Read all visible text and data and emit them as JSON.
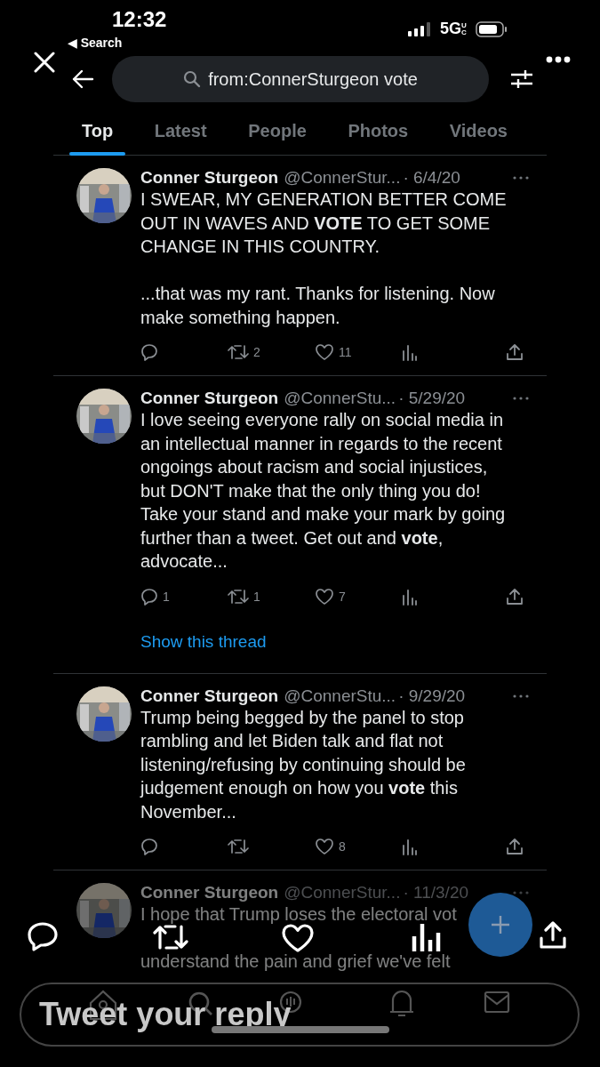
{
  "status_bar": {
    "time": "12:32",
    "back_label": "◀ Search",
    "network": "5G",
    "network_suffix": "UC"
  },
  "search": {
    "value": "from:ConnerSturgeon vote"
  },
  "tabs": [
    {
      "label": "Top",
      "selected": true
    },
    {
      "label": "Latest",
      "selected": false
    },
    {
      "label": "People",
      "selected": false
    },
    {
      "label": "Photos",
      "selected": false
    },
    {
      "label": "Videos",
      "selected": false
    }
  ],
  "tweets": [
    {
      "name": "Conner Sturgeon",
      "handle": "@ConnerStur...",
      "date": "· 6/4/20",
      "text": "I SWEAR, MY GENERATION BETTER COME OUT IN WAVES AND **VOTE** TO GET SOME CHANGE IN THIS COUNTRY.\n\n...that was my rant. Thanks for listening. Now make something happen.",
      "retweets": "2",
      "likes": "11",
      "dimmed": false
    },
    {
      "name": "Conner Sturgeon",
      "handle": "@ConnerStu...",
      "date": "· 5/29/20",
      "text": "I love seeing everyone rally on social media in an intellectual manner in regards to the recent ongoings about racism and social injustices, but DON'T make that the only thing you do! Take your stand and make your mark by going further than a tweet. Get out and **vote**, advocate...",
      "replies": "1",
      "retweets": "1",
      "likes": "7",
      "thread_link": "Show this thread",
      "dimmed": false
    },
    {
      "name": "Conner Sturgeon",
      "handle": "@ConnerStu...",
      "date": "· 9/29/20",
      "text": "Trump being begged by the panel to stop rambling and let Biden talk and flat not listening/refusing by continuing should be judgement enough on how you **vote** this November...",
      "likes": "8",
      "dimmed": false
    },
    {
      "name": "Conner Sturgeon",
      "handle": "@ConnerStur...",
      "date": "· 11/3/20",
      "text": "I hope that Trump loses the electoral vot",
      "text_end": "understand the pain and grief we've felt",
      "dimmed": true
    }
  ],
  "reply_field": {
    "placeholder": "Tweet your reply"
  }
}
